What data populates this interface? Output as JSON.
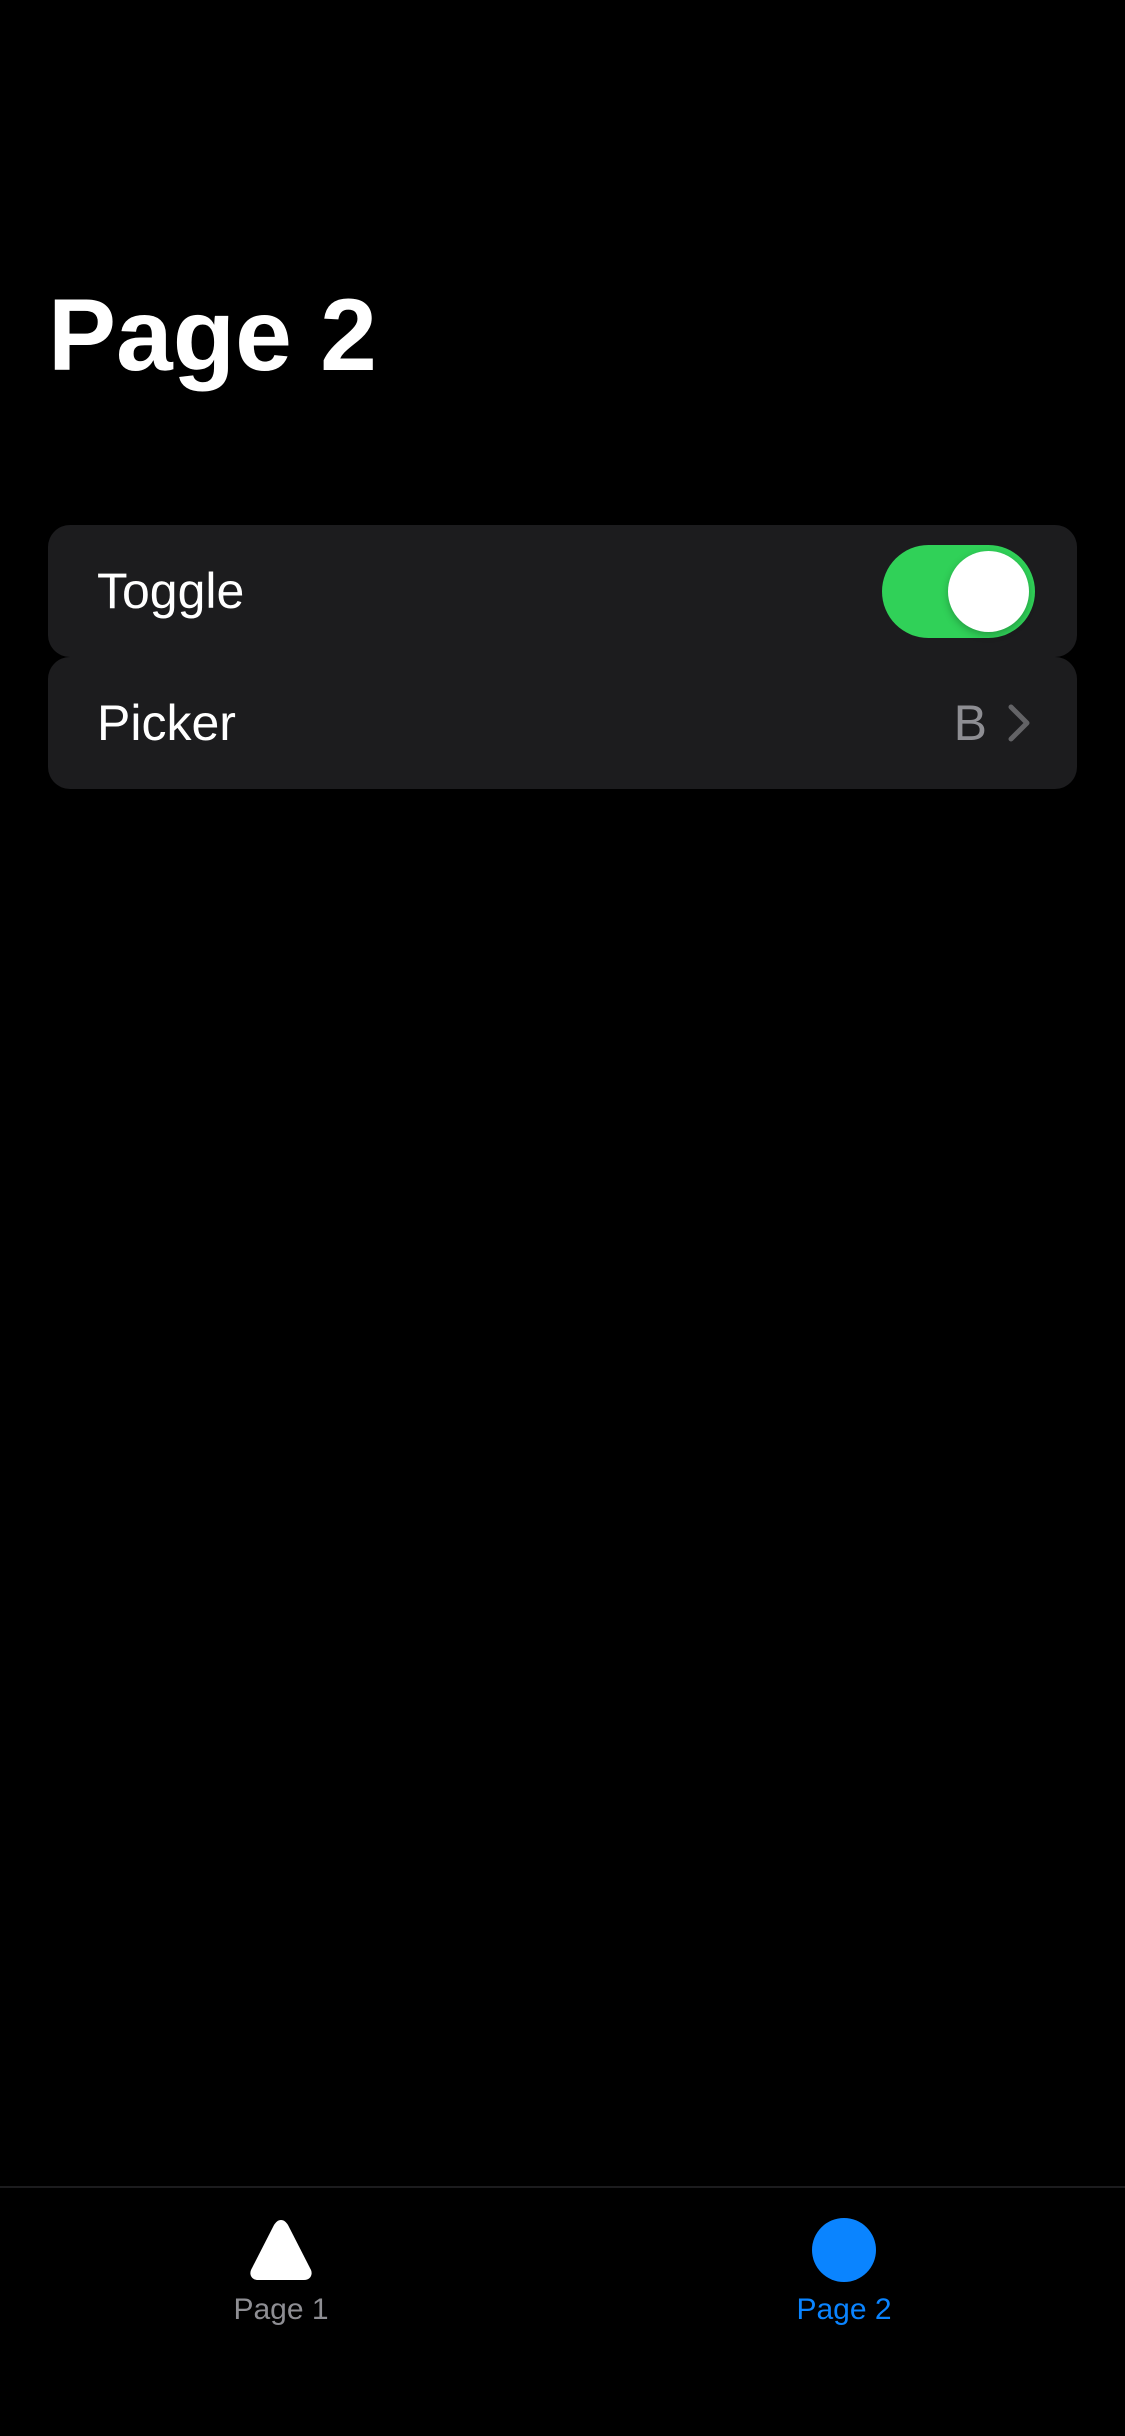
{
  "page": {
    "title": "Page 2"
  },
  "list": {
    "toggle": {
      "label": "Toggle",
      "on": true
    },
    "picker": {
      "label": "Picker",
      "value": "B"
    }
  },
  "tabbar": {
    "tabs": [
      {
        "label": "Page 1",
        "icon": "triangle-icon",
        "selected": false
      },
      {
        "label": "Page 2",
        "icon": "circle-icon",
        "selected": true
      }
    ]
  },
  "colors": {
    "background": "#000000",
    "cell_background": "#1c1c1e",
    "toggle_on": "#30d158",
    "accent": "#0a84ff",
    "secondary_text": "#8e8e93",
    "inactive_tab": "#8e8e93",
    "chevron": "#636366"
  }
}
